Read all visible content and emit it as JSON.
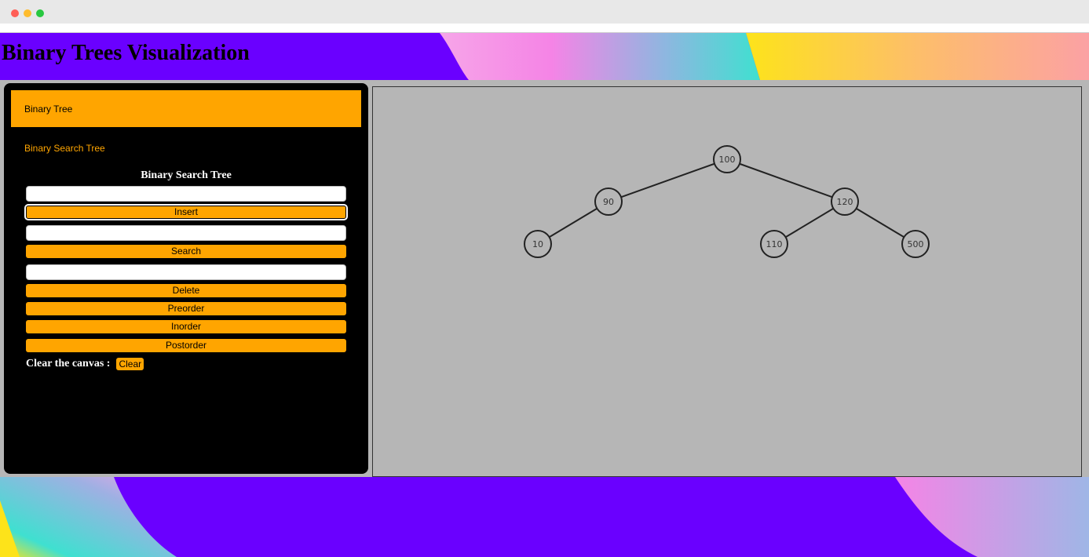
{
  "header": {
    "title": "Binary Trees Visualization"
  },
  "sidebar": {
    "tabs": [
      {
        "label": "Binary Tree",
        "active": true
      },
      {
        "label": "Binary Search Tree",
        "active": false
      }
    ],
    "panel_title": "Binary Search Tree",
    "insert_input": {
      "value": "",
      "placeholder": ""
    },
    "insert_label": "Insert",
    "search_input": {
      "value": "",
      "placeholder": ""
    },
    "search_label": "Search",
    "delete_input": {
      "value": "",
      "placeholder": ""
    },
    "delete_label": "Delete",
    "preorder_label": "Preorder",
    "inorder_label": "Inorder",
    "postorder_label": "Postorder",
    "clear_text": "Clear the canvas :",
    "clear_label": "Clear"
  },
  "tree": {
    "nodes": [
      {
        "id": "n100",
        "value": "100"
      },
      {
        "id": "n90",
        "value": "90"
      },
      {
        "id": "n120",
        "value": "120"
      },
      {
        "id": "n10",
        "value": "10"
      },
      {
        "id": "n110",
        "value": "110"
      },
      {
        "id": "n500",
        "value": "500"
      }
    ],
    "edges": [
      [
        "n100",
        "n90"
      ],
      [
        "n100",
        "n120"
      ],
      [
        "n90",
        "n10"
      ],
      [
        "n120",
        "n110"
      ],
      [
        "n120",
        "n500"
      ]
    ]
  },
  "colors": {
    "accent": "#ffa500",
    "header_bg": "#6a00ff",
    "sidebar_bg": "#000000",
    "canvas_bg": "#b6b6b6"
  }
}
